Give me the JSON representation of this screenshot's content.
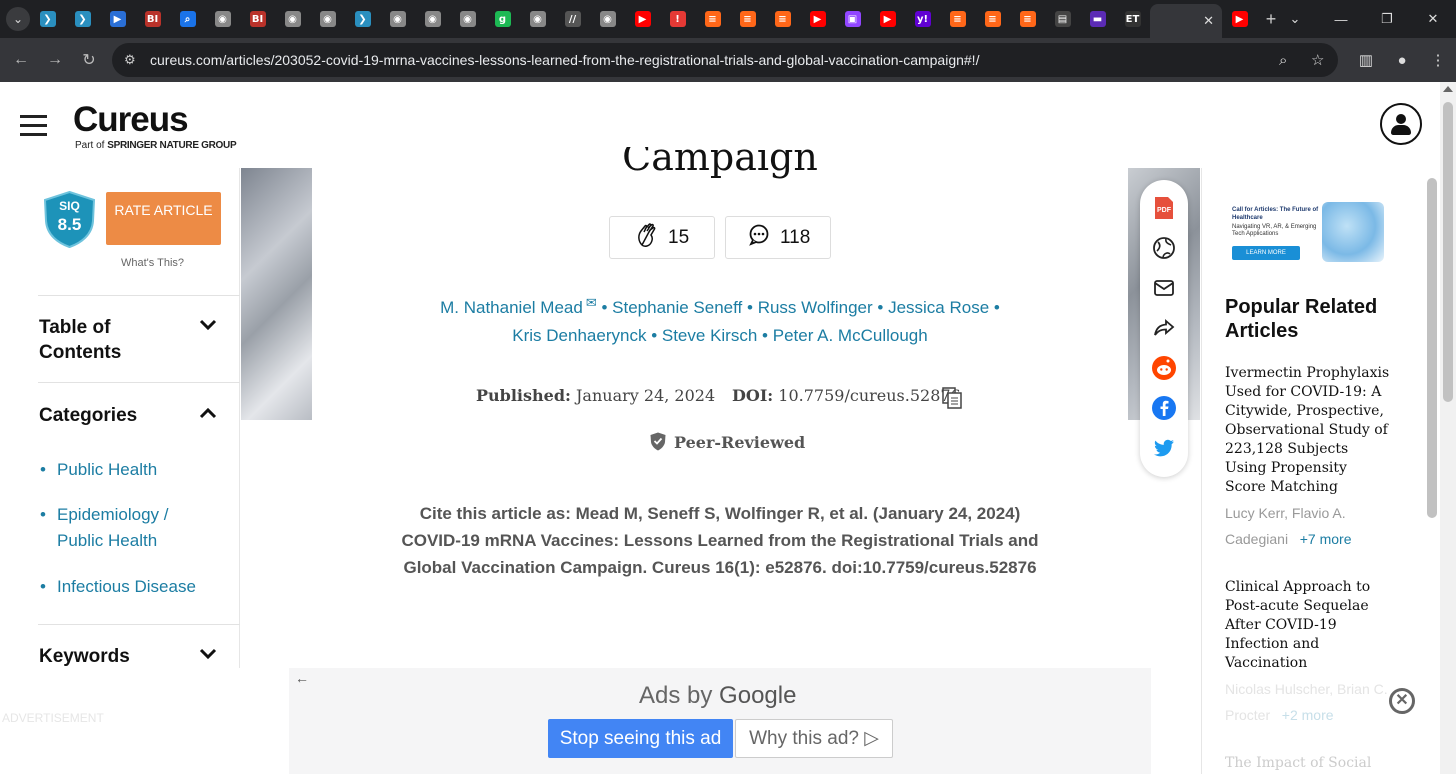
{
  "browser": {
    "tab_favicons": [
      {
        "icon": "shield-icon",
        "color": "#2a8fbf",
        "glyph": "❯"
      },
      {
        "icon": "shield-icon",
        "color": "#2a8fbf",
        "glyph": "❯"
      },
      {
        "icon": "media-icon",
        "color": "#2a6fd6",
        "glyph": "▶"
      },
      {
        "icon": "bi-icon",
        "color": "#b9322a",
        "glyph": "BI"
      },
      {
        "icon": "search-icon",
        "color": "#1a73e8",
        "glyph": "⌕"
      },
      {
        "icon": "globe-icon",
        "color": "#888888",
        "glyph": "◉"
      },
      {
        "icon": "bi-icon",
        "color": "#b9322a",
        "glyph": "BI"
      },
      {
        "icon": "globe-icon",
        "color": "#888888",
        "glyph": "◉"
      },
      {
        "icon": "globe-icon",
        "color": "#888888",
        "glyph": "◉"
      },
      {
        "icon": "shield-icon",
        "color": "#2a8fbf",
        "glyph": "❯"
      },
      {
        "icon": "globe-icon",
        "color": "#888888",
        "glyph": "◉"
      },
      {
        "icon": "globe-icon",
        "color": "#888888",
        "glyph": "◉"
      },
      {
        "icon": "globe-icon",
        "color": "#888888",
        "glyph": "◉"
      },
      {
        "icon": "g-icon",
        "color": "#1db954",
        "glyph": "g"
      },
      {
        "icon": "globe-icon",
        "color": "#888888",
        "glyph": "◉"
      },
      {
        "icon": "text-icon",
        "color": "#555555",
        "glyph": "//"
      },
      {
        "icon": "globe-icon",
        "color": "#888888",
        "glyph": "◉"
      },
      {
        "icon": "youtube-icon",
        "color": "#ff0000",
        "glyph": "▶"
      },
      {
        "icon": "alert-icon",
        "color": "#e53935",
        "glyph": "!"
      },
      {
        "icon": "bookmark-icon",
        "color": "#ff6719",
        "glyph": "≡"
      },
      {
        "icon": "bookmark-icon",
        "color": "#ff6719",
        "glyph": "≡"
      },
      {
        "icon": "bookmark-icon",
        "color": "#ff6719",
        "glyph": "≡"
      },
      {
        "icon": "youtube-icon",
        "color": "#ff0000",
        "glyph": "▶"
      },
      {
        "icon": "twitch-icon",
        "color": "#9146ff",
        "glyph": "▣"
      },
      {
        "icon": "youtube-icon",
        "color": "#ff0000",
        "glyph": "▶"
      },
      {
        "icon": "yahoo-icon",
        "color": "#6001d2",
        "glyph": "y!"
      },
      {
        "icon": "bookmark-icon",
        "color": "#ff6719",
        "glyph": "≡"
      },
      {
        "icon": "bookmark-icon",
        "color": "#ff6719",
        "glyph": "≡"
      },
      {
        "icon": "bookmark-icon",
        "color": "#ff6719",
        "glyph": "≡"
      },
      {
        "icon": "news-icon",
        "color": "#444444",
        "glyph": "▤"
      },
      {
        "icon": "purple-icon",
        "color": "#5b2bb5",
        "glyph": "▬"
      },
      {
        "icon": "et-icon",
        "color": "#333333",
        "glyph": "ET"
      }
    ],
    "active_tab_close": "✕",
    "last_tab": {
      "icon": "youtube-icon",
      "color": "#ff0000",
      "glyph": "▶"
    },
    "new_tab": "+",
    "url": "cureus.com/articles/203052-covid-19-mrna-vaccines-lessons-learned-from-the-registrational-trials-and-global-vaccination-campaign#!/"
  },
  "header": {
    "logo": "Cureus",
    "logo_sub_prefix": "Part of ",
    "logo_sub_brand": "SPRINGER NATURE GROUP"
  },
  "sidebar": {
    "siq_label": "SIQ",
    "siq_score": "8.5",
    "rate_button": "RATE ARTICLE",
    "whats_this": "What's This?",
    "toc_title": "Table of Contents",
    "categories_title": "Categories",
    "categories": [
      "Public Health",
      "Epidemiology / Public Health",
      "Infectious Disease"
    ],
    "keywords_title": "Keywords"
  },
  "article": {
    "title_fragment": "Campaign",
    "claps": "15",
    "comments": "118",
    "authors_line1": [
      "M. Nathaniel Mead",
      "Stephanie Seneff",
      "Russ Wolfinger",
      "Jessica Rose"
    ],
    "authors_line2": [
      "Kris Denhaerynck",
      "Steve Kirsch",
      "Peter A. McCullough"
    ],
    "published_label": "Published:",
    "published_date": "January 24, 2024",
    "doi_label": "DOI:",
    "doi_value": "10.7759/cureus.52876",
    "peer_reviewed": "Peer-Reviewed",
    "cite_prefix": "Cite this article as:",
    "cite_text": "Mead M, Seneff S, Wolfinger R, et al. (January 24, 2024) COVID-19 mRNA Vaccines: Lessons Learned from the Registrational Trials and Global Vaccination Campaign. Cureus 16(1): e52876. doi:10.7759/cureus.52876"
  },
  "right_panel": {
    "ad": {
      "heading": "Call for Articles: The Future of Healthcare",
      "body": "Navigating VR, AR, & Emerging Tech Applications",
      "button": "LEARN MORE"
    },
    "popular_title": "Popular Related Articles",
    "related": [
      {
        "title": "Ivermectin Prophylaxis Used for COVID-19: A Citywide, Prospective, Observational Study of 223,128 Subjects Using Propensity Score Matching",
        "authors": "Lucy Kerr, Flavio A. Cadegiani",
        "more": "+7 more"
      },
      {
        "title": "Clinical Approach to Post-acute Sequelae After COVID-19 Infection and Vaccination",
        "authors": "Nicolas Hulscher, Brian C. Procter",
        "more": "+2 more"
      },
      {
        "title": "The Impact of Social",
        "authors": "",
        "more": ""
      }
    ]
  },
  "ad_overlay": {
    "back": "←",
    "ads_by": "Ads by",
    "brand": "Google",
    "stop": "Stop seeing this ad",
    "why": "Why this ad?",
    "why_icon": "▷",
    "advertisement": "ADVERTISEMENT",
    "close": "✕"
  },
  "share": {
    "pdf": "PDF"
  }
}
